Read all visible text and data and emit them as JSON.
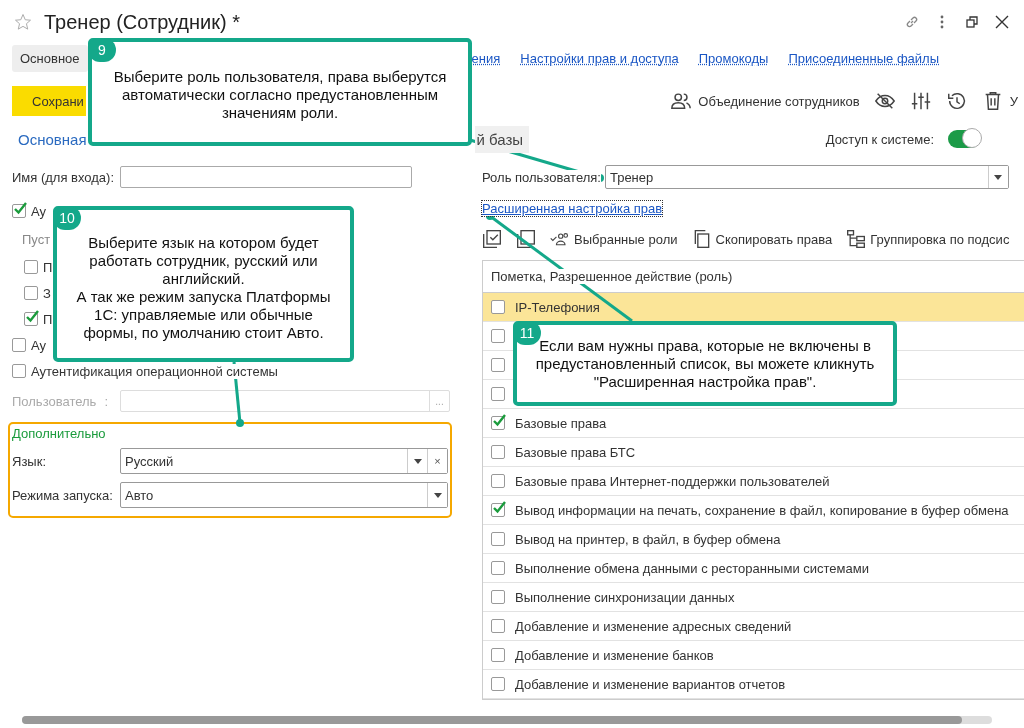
{
  "window": {
    "title": "Тренер (Сотрудник) *"
  },
  "sections": [
    {
      "label": "Основное",
      "selected": true
    },
    {
      "label": "ения",
      "selected": false
    },
    {
      "label": "Настройки прав и доступа",
      "selected": false
    },
    {
      "label": "Промокоды",
      "selected": false
    },
    {
      "label": "Присоединенные файлы",
      "selected": false
    }
  ],
  "toolbar": {
    "save": "Сохрани",
    "merge": "Объединение сотрудников",
    "delete": "У"
  },
  "tabs": [
    {
      "label": "Основная",
      "selected": true
    },
    {
      "label": "й базы",
      "selected": false
    }
  ],
  "access": {
    "label": "Доступ к системе:",
    "on": true
  },
  "login": {
    "label": "Имя (для входа):"
  },
  "auth_options": [
    {
      "label": "Ау",
      "checked": true,
      "note": "Пуст",
      "children": [
        {
          "label": "П",
          "checked": false
        },
        {
          "label": "З",
          "checked": false
        },
        {
          "label": "П",
          "checked": true
        }
      ]
    },
    {
      "label": "Ау",
      "checked": false
    },
    {
      "label": "Аутентификация операционной системы",
      "checked": false
    }
  ],
  "os_user": {
    "label": "Пользователь",
    "colon": ":",
    "disabled": true,
    "button": "..."
  },
  "extra": {
    "title": "Дополнительно",
    "language": {
      "label": "Язык:",
      "value": "Русский",
      "clear": "×"
    },
    "launch_mode": {
      "label": "Режима запуска:",
      "value": "Авто"
    }
  },
  "role": {
    "label": "Роль пользователя:",
    "value": "Тренер"
  },
  "advanced_link": "Расширенная настройка прав",
  "rights_toolbar": [
    "Выбранные роли",
    "Скопировать права",
    "Группировка по подсис"
  ],
  "rights": {
    "header": "Пометка, Разрешенное действие (роль)",
    "rows": [
      {
        "label": "IP-Телефония",
        "checked": false,
        "selected": true
      },
      {
        "checked": false,
        "selected": false
      },
      {
        "checked": false,
        "selected": false
      },
      {
        "checked": false,
        "selected": false
      },
      {
        "label": "Базовые права",
        "checked": true,
        "selected": false
      },
      {
        "label": "Базовые права БТС",
        "checked": false,
        "selected": false
      },
      {
        "label": "Базовые права Интернет-поддержки пользователей",
        "checked": false,
        "selected": false
      },
      {
        "label": "Вывод информации на печать, сохранение в файл, копирование в буфер обмена",
        "checked": true,
        "selected": false
      },
      {
        "label": "Вывод на принтер, в файл, в буфер обмена",
        "checked": false,
        "selected": false
      },
      {
        "label": "Выполнение обмена данными с ресторанными системами",
        "checked": false,
        "selected": false
      },
      {
        "label": "Выполнение синхронизации данных",
        "checked": false,
        "selected": false
      },
      {
        "label": "Добавление и изменение адресных сведений",
        "checked": false,
        "selected": false
      },
      {
        "label": "Добавление и изменение банков",
        "checked": false,
        "selected": false
      },
      {
        "label": "Добавление и изменение вариантов отчетов",
        "checked": false,
        "selected": false
      }
    ]
  },
  "callouts": [
    {
      "number": "9",
      "text": "Выберите роль пользователя, права выберутся автоматически согласно предустановленным значениям роли."
    },
    {
      "number": "10",
      "text": "Выберите язык на котором будет работать сотрудник, русский или английский.\nА так же режим запуска Платформы 1С: управляемые или обычные формы, по умолчанию стоит Авто."
    },
    {
      "number": "11",
      "text": "Если вам нужны права, которые не включены в предустановленный список, вы можете кликнуть \"Расширенная настройка прав\"."
    }
  ]
}
